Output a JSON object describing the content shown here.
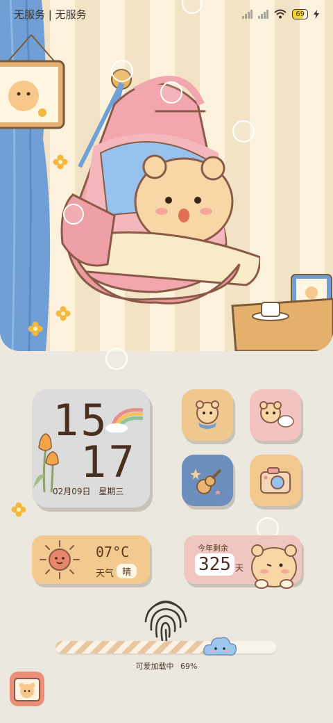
{
  "status_bar": {
    "carrier": "无服务 | 无服务",
    "battery": "69"
  },
  "clock_widget": {
    "hour": "15",
    "minute": "17",
    "date": "02月09日",
    "weekday": "星期三"
  },
  "weather_widget": {
    "temperature": "07°C",
    "condition_label": "天气",
    "condition_value": "晴"
  },
  "countdown_widget": {
    "label": "今年剩余",
    "days": "325",
    "unit": "天"
  },
  "loading": {
    "label": "可爱加载中",
    "percent": "69%",
    "progress_fraction": 0.69
  },
  "icons": {
    "app1": "tiger-scarf-icon",
    "app2": "tiger-cloud-icon",
    "app3": "guitar-star-icon",
    "app4": "camera-icon",
    "dock": "tiger-photo-icon",
    "fingerprint": "fingerprint-icon"
  },
  "colors": {
    "background": "#ece8df",
    "clock_bg": "#dcdcdc",
    "app1_bg": "#f0c88f",
    "app2_bg": "#f2c3c0",
    "app3_bg": "#6d8fbe",
    "app4_bg": "#f2c88f",
    "weather_bg": "#f2c98f",
    "countdown_bg": "#f0c7c0"
  }
}
